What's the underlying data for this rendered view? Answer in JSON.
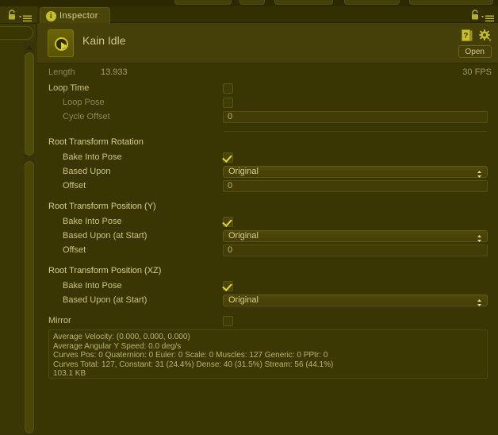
{
  "window": {
    "tab_label": "Inspector",
    "tab_icon": "info-icon",
    "lock_icon": "lock-icon",
    "menu_icon": "hamburger-menu-icon"
  },
  "header": {
    "object_name": "Kain Idle",
    "thumbnail_icon": "animation-clip-play-icon",
    "help_icon": "help-book-icon",
    "gear_icon": "gear-icon",
    "open_button": "Open"
  },
  "info": {
    "length_label": "Length",
    "length_value": "13.933",
    "fps_value": "30 FPS"
  },
  "properties": [
    {
      "label": "Loop Time",
      "type": "checkbox",
      "checked": false,
      "indent": 0,
      "dim": false
    },
    {
      "label": "Loop Pose",
      "type": "checkbox",
      "checked": false,
      "indent": 1,
      "dim": true
    },
    {
      "label": "Cycle Offset",
      "type": "field",
      "value": "0",
      "indent": 1,
      "dim": true
    }
  ],
  "sections": [
    {
      "title": "Root Transform Rotation",
      "rows": [
        {
          "label": "Bake Into Pose",
          "type": "checkbox",
          "checked": true
        },
        {
          "label": "Based Upon",
          "type": "popup",
          "value": "Original"
        },
        {
          "label": "Offset",
          "type": "field",
          "value": "0"
        }
      ]
    },
    {
      "title": "Root Transform Position (Y)",
      "rows": [
        {
          "label": "Bake Into Pose",
          "type": "checkbox",
          "checked": true
        },
        {
          "label": "Based Upon (at Start)",
          "type": "popup",
          "value": "Original"
        },
        {
          "label": "Offset",
          "type": "field",
          "value": "0"
        }
      ]
    },
    {
      "title": "Root Transform Position (XZ)",
      "rows": [
        {
          "label": "Bake Into Pose",
          "type": "checkbox",
          "checked": true
        },
        {
          "label": "Based Upon (at Start)",
          "type": "popup",
          "value": "Original"
        }
      ]
    }
  ],
  "mirror": {
    "label": "Mirror",
    "type": "checkbox",
    "checked": false
  },
  "stats": [
    "Average Velocity: (0.000, 0.000, 0.000)",
    "Average Angular Y Speed: 0.0 deg/s",
    "Curves Pos: 0 Quaternion: 0 Euler: 0 Scale: 0 Muscles: 127 Generic: 0 PPtr: 0",
    "Curves Total: 127, Constant: 31 (24.4%) Dense: 40 (31.5%) Stream: 56 (44.1%)",
    "103.1 KB"
  ],
  "colors": {
    "background": "#3a3603",
    "header_band": "#45400a",
    "accent_check": "#e6da2c",
    "text": "#ccc481",
    "text_dim": "#8d874b"
  },
  "toolbar_strip_buttons": [
    5
  ]
}
